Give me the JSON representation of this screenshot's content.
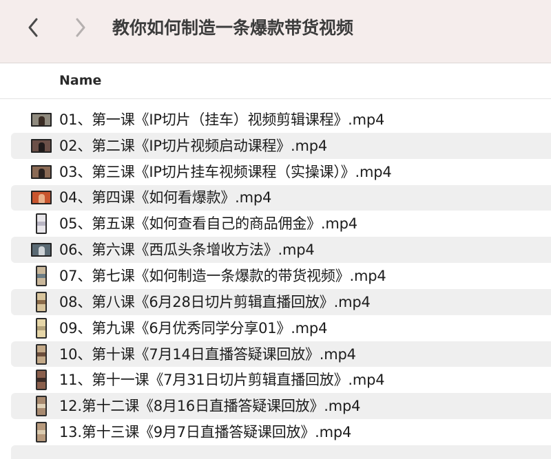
{
  "window": {
    "title": "教你如何制造一条爆款带货视频"
  },
  "toolbar": {
    "back_icon": "chevron-left-icon",
    "forward_icon": "chevron-right-icon"
  },
  "columns": {
    "name_label": "Name"
  },
  "files": [
    {
      "name": "01、第一课《IP切片（挂车）视频剪辑课程》.mp4",
      "thumb": "landscape",
      "bg": "#8f8a7e",
      "fig": "#3a2c24"
    },
    {
      "name": "02、第二课《IP切片视频启动课程》.mp4",
      "thumb": "landscape",
      "bg": "#6b5048",
      "fig": "#1e1a1a"
    },
    {
      "name": "03、第三课《IP切片挂车视频课程（实操课）》.mp4",
      "thumb": "landscape",
      "bg": "#8a6a55",
      "fig": "#2a2220"
    },
    {
      "name": "04、第四课《如何看爆款》.mp4",
      "thumb": "landscape",
      "bg": "#c8552e",
      "fig": "#e9b08a"
    },
    {
      "name": "05、第五课《如何查看自己的商品佣金》.mp4",
      "thumb": "portrait",
      "bg": "#e8e6ea",
      "band": "#b9b6c4"
    },
    {
      "name": "06、第六课《西瓜头条增收方法》.mp4",
      "thumb": "landscape",
      "bg": "#5a6a74",
      "fig": "#cfd4d8"
    },
    {
      "name": "07、第七课《如何制造一条爆款的带货视频》.mp4",
      "thumb": "portrait",
      "bg": "#c9b79a",
      "band": "#6c7d86"
    },
    {
      "name": "08、第八课《6月28日切片剪辑直播回放》.mp4",
      "thumb": "portrait",
      "bg": "#d8c49c",
      "band": "#8b6b4a"
    },
    {
      "name": "09、第九课《6月优秀同学分享01》.mp4",
      "thumb": "portrait",
      "bg": "#e6d6a8",
      "band": "#b3a27a"
    },
    {
      "name": "10、第十课《7月14日直播答疑课回放》.mp4",
      "thumb": "portrait",
      "bg": "#c3a988",
      "band": "#6c4e3c"
    },
    {
      "name": "11、第十一课《7月31日切片剪辑直播回放》.mp4",
      "thumb": "portrait",
      "bg": "#8a5f4c",
      "band": "#3a2a25"
    },
    {
      "name": "12.第十二课《8月16日直播答疑课回放》.mp4",
      "thumb": "portrait",
      "bg": "#a88a70",
      "band": "#e0d2b8"
    },
    {
      "name": "13.第十三课《9月7日直播答疑课回放》.mp4",
      "thumb": "portrait",
      "bg": "#b79a7d",
      "band": "#dacbb0"
    }
  ]
}
